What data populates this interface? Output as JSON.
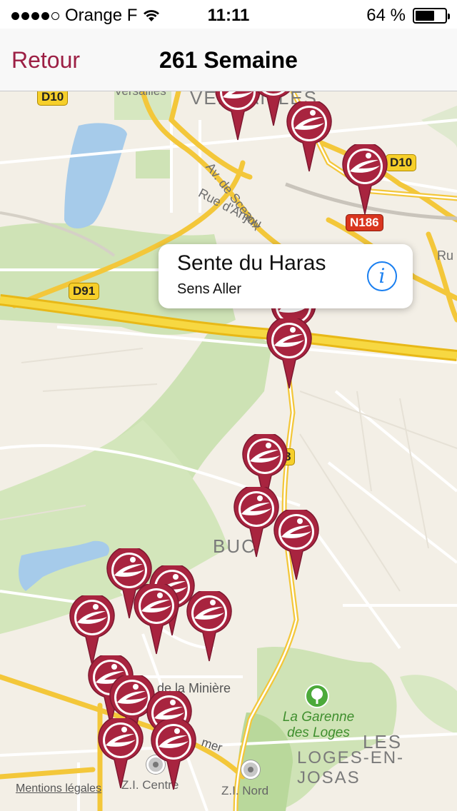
{
  "status_bar": {
    "carrier": "Orange F",
    "time": "11:11",
    "battery_percent": "64 %",
    "battery_level": 0.64,
    "signal_bars": 4
  },
  "nav": {
    "back_label": "Retour",
    "title": "261 Semaine"
  },
  "callout": {
    "title": "Sente du Haras",
    "subtitle": "Sens Aller",
    "info_glyph": "i"
  },
  "map": {
    "road_labels": {
      "d10_a": "D10",
      "d10_b": "D10",
      "n186": "N186",
      "d91": "D91",
      "route_8": "8"
    },
    "places": {
      "versailles_small": "Versailles",
      "versailles_big": "VERSAILLES",
      "av_sceaux": "Av. de Sceaux",
      "rue_anjou": "Rue d'Anjou",
      "bucq": "BUC",
      "de_la_miniere": "de la Minière",
      "garenne": "La Garenne",
      "des_loges": "des Loges",
      "les": "LES",
      "loges_en_josas": "LOGES-EN-JOSAS",
      "zi_centre": "Z.I. Centre",
      "zi_nord": "Z.I. Nord",
      "ru": "Ru",
      "mer": "mer"
    },
    "legal_link": "Mentions légales",
    "pin_icon": "bus-stop-pin-icon",
    "pin_color": "#a8243f",
    "accent_color": "#9c1f44"
  }
}
